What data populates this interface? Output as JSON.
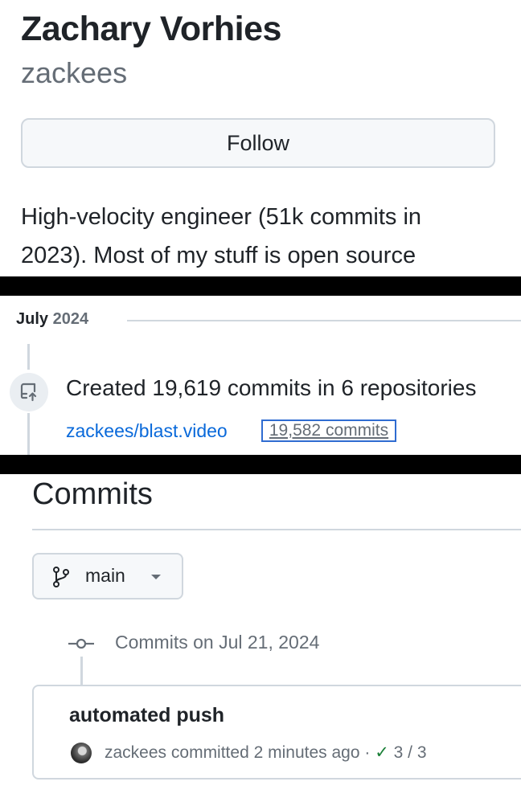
{
  "profile": {
    "name": "Zachary Vorhies",
    "login": "zackees",
    "follow_label": "Follow",
    "bio_line1": "High-velocity engineer (51k commits in",
    "bio_line2": "2023). Most of my stuff is open source"
  },
  "activity": {
    "month": "July",
    "year": "2024",
    "title": "Created 19,619 commits in 6 repositories",
    "repo": "zackees/blast.video",
    "repo_commits": "19,582 commits",
    "icon": "repo-push-icon"
  },
  "commits": {
    "heading": "Commits",
    "branch": "main",
    "date_label": "Commits on Jul 21, 2024",
    "item": {
      "message": "automated push",
      "author": "zackees",
      "verb": "committed",
      "time": "2 minutes ago",
      "separator": "·",
      "check_glyph": "✓",
      "checks": "3 / 3"
    }
  },
  "colors": {
    "link": "#0969da",
    "success": "#1a7f37",
    "highlight_box": "#2f6cd1"
  }
}
